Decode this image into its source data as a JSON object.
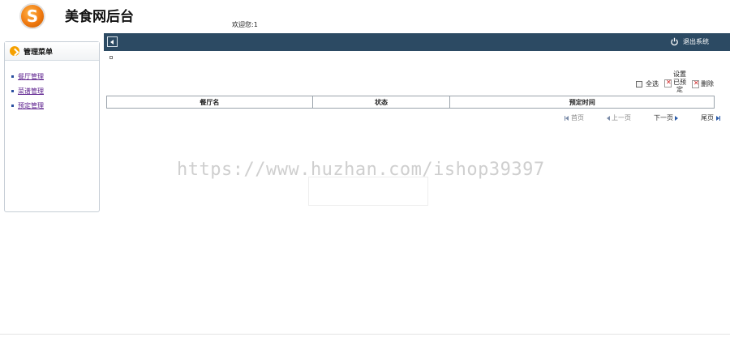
{
  "header": {
    "logo_letter": "S",
    "site_title": "美食网后台",
    "welcome": "欢迎您:1"
  },
  "topbar": {
    "logout_label": "退出系统"
  },
  "sidebar": {
    "title": "管理菜单",
    "items": [
      {
        "label": "餐厅管理"
      },
      {
        "label": "菜谱管理"
      },
      {
        "label": "预定管理"
      }
    ]
  },
  "actions": {
    "select_all": "全选",
    "set_booked": "设置已预定",
    "delete": "删除"
  },
  "table": {
    "columns": [
      "餐厅名",
      "状态",
      "预定时间"
    ]
  },
  "pager": {
    "first": "首页",
    "prev": "上一页",
    "next": "下一页",
    "last": "尾页"
  },
  "watermark": "https://www.huzhan.com/ishop39397",
  "colors": {
    "topbar": "#2c4a63",
    "link": "#5b1e8c",
    "logo": "#f07a10",
    "accent_arrow": "#f5a000"
  }
}
